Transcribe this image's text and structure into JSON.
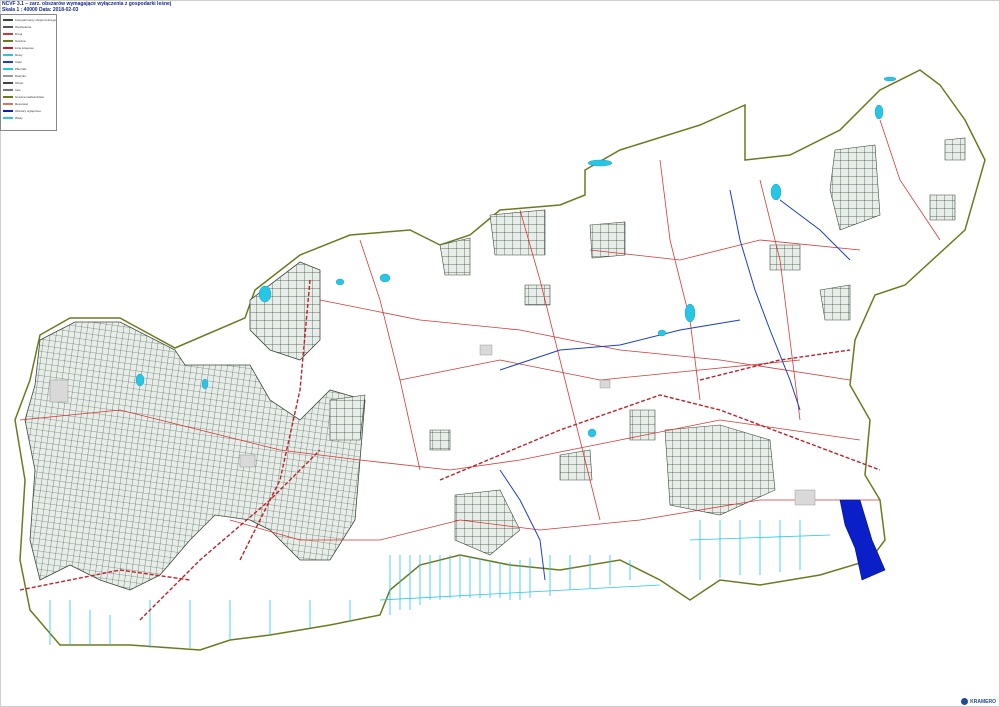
{
  "header": {
    "title_line": "NCVF 3.1 – zarz. obszarów wymagające wyłączenia z gospodarki leśnej",
    "scale_line": "Skala 1 : 40000  Data: 2018-02-03"
  },
  "legend": {
    "rows": [
      "Kompartmenty obrębu leśnego",
      "Wydzielenia",
      "Drogi",
      "Granica",
      "Linie kolejowe",
      "Rowy",
      "Cieki",
      "Zbiorniki",
      "Budynki",
      "Obręb",
      "Inne",
      "Granica nadleśnictwa",
      "Rezerwat",
      "Obszary wyłączone",
      "Wody"
    ]
  },
  "map": {
    "colors": {
      "outline": "#6b7a1f",
      "road_red": "#d23a3a",
      "railway": "#c0202a",
      "water_cyan": "#27c6e6",
      "river_blue": "#1a3fc4",
      "forest_grid": "#3a4a3a",
      "forest_fill": "#e7ede8",
      "exclusion_blue": "#0a1fc8"
    }
  },
  "logo": {
    "text": "KRAMERO"
  }
}
